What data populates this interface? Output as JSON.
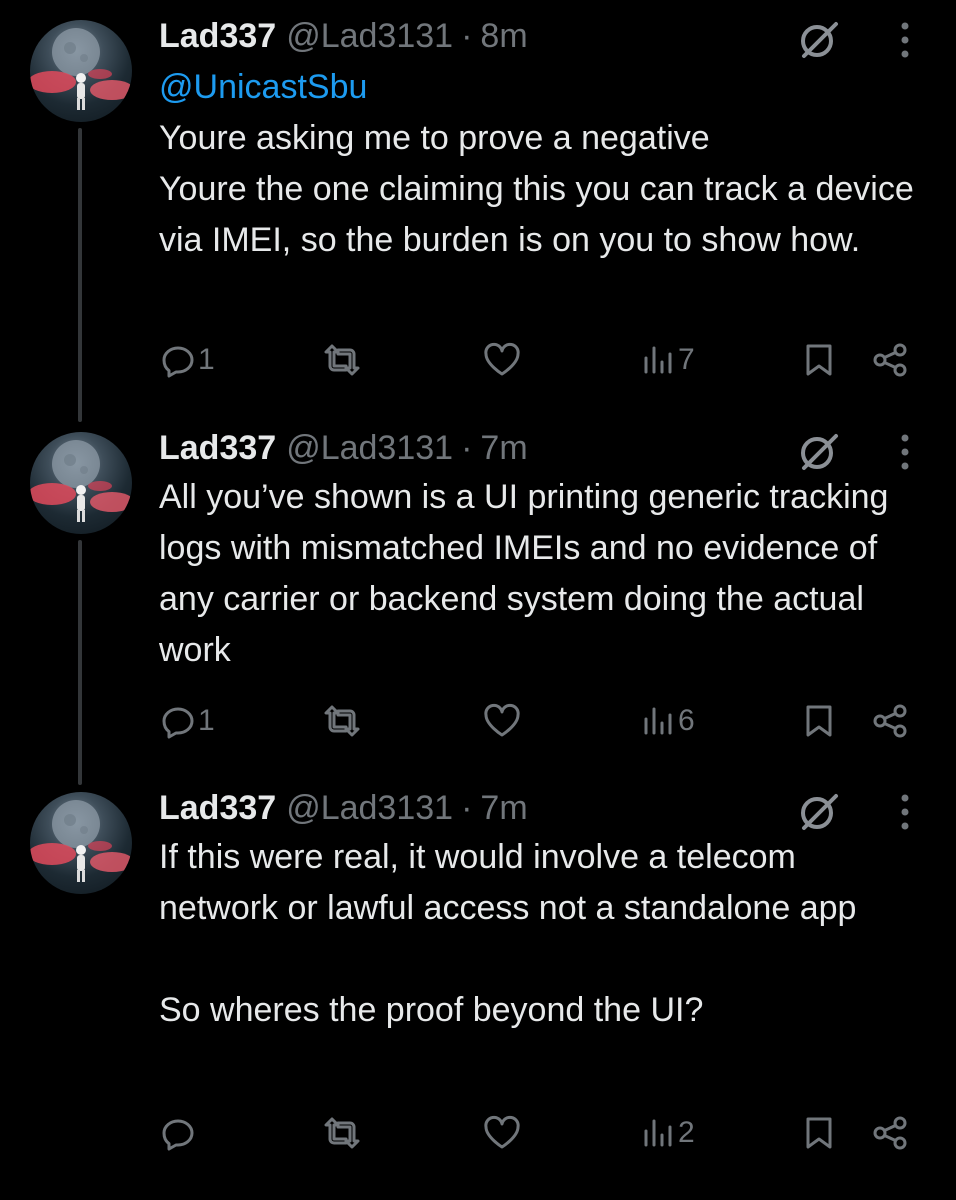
{
  "colors": {
    "background": "#000000",
    "text": "#e7e9ea",
    "secondary": "#71767b",
    "mention": "#1d9bf0",
    "thread_line": "#333639"
  },
  "tweets": [
    {
      "name": "Lad337",
      "handle": "@Lad3131",
      "separator": "·",
      "time": "8m",
      "mention": "@UnicastSbu",
      "text": "Youre asking me to prove a negative\nYoure the one claiming this you can track a device via IMEI, so the burden is on you to show how.",
      "replies": "1",
      "views": "7"
    },
    {
      "name": "Lad337",
      "handle": "@Lad3131",
      "separator": "·",
      "time": "7m",
      "mention": "",
      "text": "All you’ve shown is a UI printing generic tracking logs with mismatched IMEIs and no evidence of any carrier or backend system doing the actual work",
      "replies": "1",
      "views": "6"
    },
    {
      "name": "Lad337",
      "handle": "@Lad3131",
      "separator": "·",
      "time": "7m",
      "mention": "",
      "text": "If this were real, it would involve a telecom network or lawful access not a standalone app\n\nSo wheres the proof beyond the UI?",
      "replies": "",
      "views": "2"
    }
  ],
  "icons": {
    "reply": "reply-icon",
    "repost": "repost-icon",
    "like": "like-icon",
    "views": "views-icon",
    "bookmark": "bookmark-icon",
    "share": "share-icon",
    "grok": "grok-icon",
    "more": "more-options-icon"
  }
}
